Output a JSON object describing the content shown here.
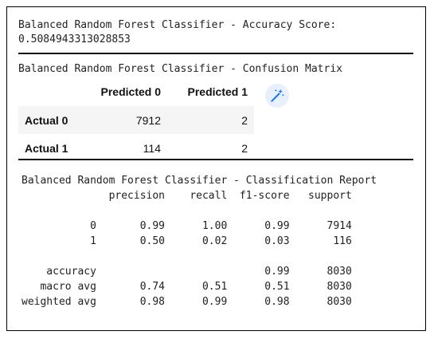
{
  "accuracy_title": "Balanced Random Forest Classifier - Accuracy Score:",
  "accuracy_value": "0.5084943313028853",
  "confusion_matrix": {
    "title": "Balanced Random Forest Classifier - Confusion Matrix",
    "columns": [
      "",
      "Predicted 0",
      "Predicted 1"
    ],
    "rows": [
      {
        "label": "Actual 0",
        "values": [
          "7912",
          "2"
        ]
      },
      {
        "label": "Actual 1",
        "values": [
          "114",
          "2"
        ]
      }
    ]
  },
  "magic_wand_icon": "magic-wand-icon",
  "classification_report": {
    "title": "Balanced Random Forest Classifier - Classification Report",
    "text": "              precision    recall  f1-score   support\n\n           0       0.99      1.00      0.99      7914\n           1       0.50      0.02      0.03       116\n\n    accuracy                           0.99      8030\n   macro avg       0.74      0.51      0.51      8030\nweighted avg       0.98      0.99      0.98      8030"
  },
  "colors": {
    "accent": "#1a73e8",
    "icon_bg": "#e8f0fe",
    "row_stripe": "#f5f5f5"
  }
}
